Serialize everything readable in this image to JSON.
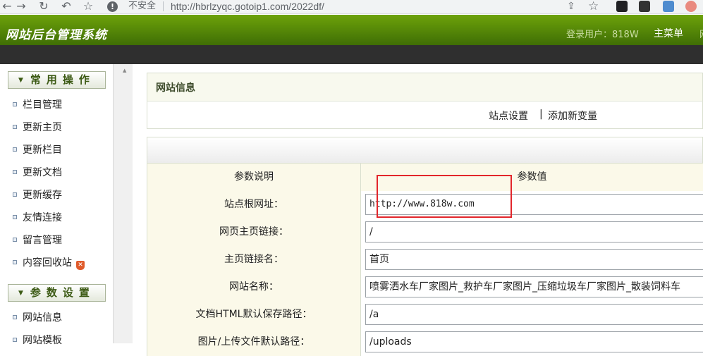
{
  "browser": {
    "insecure_label": "不安全",
    "url": "http://hbrlzyqc.gotoip1.com/2022df/"
  },
  "header": {
    "title": "网站后台管理系统",
    "login_user": "登录用户：818W",
    "main_menu": "主菜单",
    "extra": "网"
  },
  "sidebar": {
    "section1": "常用操作",
    "items1": [
      "栏目管理",
      "更新主页",
      "更新栏目",
      "更新文档",
      "更新缓存",
      "友情连接",
      "留言管理",
      "内容回收站"
    ],
    "section2": "参数设置",
    "items2": [
      "网站信息",
      "网站模板"
    ]
  },
  "main": {
    "panel_title": "网站信息",
    "link_site_settings": "站点设置",
    "link_separator": "|",
    "link_add_variable": "添加新变量",
    "table": {
      "col_param_desc": "参数说明",
      "col_param_value": "参数值",
      "rows": [
        {
          "label": "站点根网址：",
          "value": "http://www.818w.com"
        },
        {
          "label": "网页主页链接：",
          "value": "/"
        },
        {
          "label": "主页链接名：",
          "value": "首页"
        },
        {
          "label": "网站名称：",
          "value": "喷雾洒水车厂家图片_救护车厂家图片_压缩垃圾车厂家图片_散装饲料车"
        },
        {
          "label": "文档HTML默认保存路径：",
          "value": "/a"
        },
        {
          "label": "图片/上传文件默认路径：",
          "value": "/uploads"
        }
      ]
    }
  },
  "colors": {
    "header_green": "#5a8f08",
    "highlight_red": "#e2262b"
  }
}
